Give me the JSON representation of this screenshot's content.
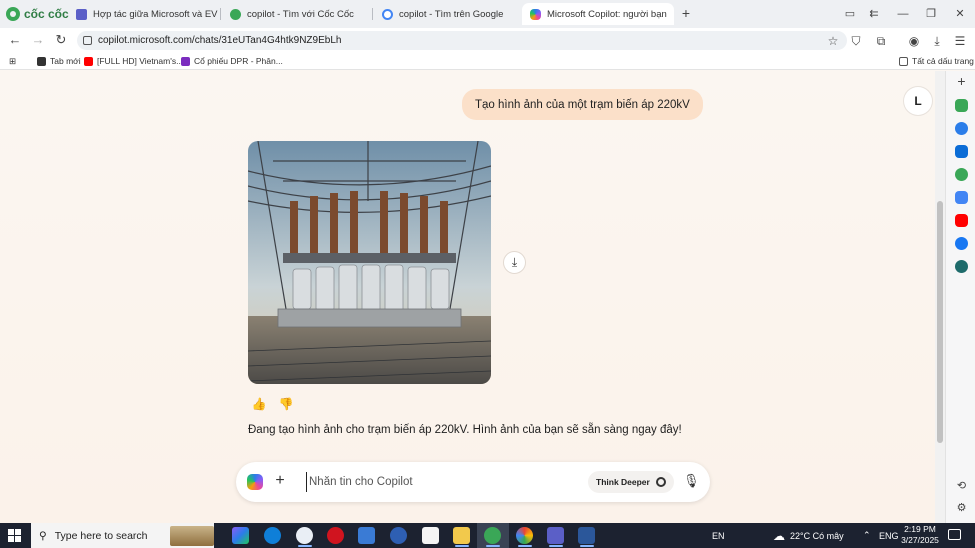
{
  "browser": {
    "brand": "cốc cốc",
    "tabs": [
      {
        "title": "Hợp tác giữa Microsoft và EVN N",
        "icon": "microsoft-teams-icon",
        "color": "#5b5fc7"
      },
      {
        "title": "copilot - Tìm với Cốc Cốc",
        "icon": "coccoc-icon",
        "color": "#3aa757"
      },
      {
        "title": "copilot - Tìm trên Google",
        "icon": "google-icon",
        "color": "#4285f4"
      },
      {
        "title": "Microsoft Copilot: người bạn",
        "icon": "copilot-icon",
        "color": "#8b5cf6",
        "active": true
      }
    ],
    "new_tab": "+",
    "window_controls": {
      "minimize": "—",
      "maximize": "❐",
      "close": "✕"
    },
    "url": "copilot.microsoft.com/chats/31eUTan4G4htk9NZ9EbLh",
    "bookmarks": [
      {
        "label": "Tab mới",
        "color": "#333333"
      },
      {
        "label": "[FULL HD] Vietnam's...",
        "color": "#ff0000"
      },
      {
        "label": "Cổ phiếu DPR - Phân...",
        "color": "#7b2cbf"
      }
    ],
    "all_bookmarks": "Tất cả dấu trang"
  },
  "chat": {
    "user_avatar": "L",
    "user_message": "Tạo hình ảnh của một trạm biến áp 220kV",
    "assistant_reply": "Đang tạo hình ảnh cho trạm biến áp 220kV. Hình ảnh của bạn sẽ sẵn sàng ngay đây!",
    "download_icon": "⤓",
    "like_icon": "👍",
    "dislike_icon": "👎"
  },
  "composer": {
    "placeholder": "Nhắn tin cho Copilot",
    "value": "",
    "think_deeper": "Think Deeper"
  },
  "taskbar": {
    "search_placeholder": "Type here to search",
    "input_lang": "EN",
    "weather": "22°C Có mây",
    "keyboard": "ENG",
    "time": "2:19 PM",
    "date": "3/27/2025"
  },
  "colors": {
    "accent": "#fbe0c9",
    "page_bg": "#fbf6f1",
    "taskbar_bg": "#1c2230"
  }
}
